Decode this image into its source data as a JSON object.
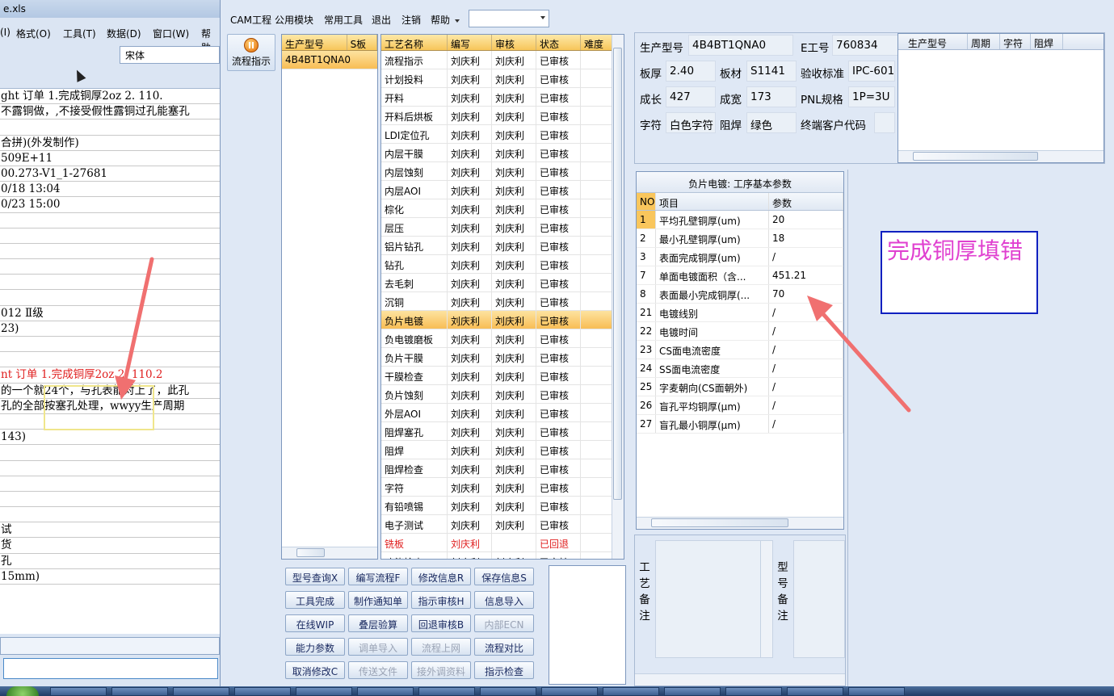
{
  "excel": {
    "title": "e.xls",
    "menu": [
      "(I)",
      "格式(O)",
      "工具(T)",
      "数据(D)",
      "窗口(W)",
      "帮助"
    ],
    "font_name": "宋体",
    "rows": [
      "ght 订单  1.完成铜厚2oz  2.  110.",
      "不露铜做，,不接受假性露铜过孔能塞孔",
      "",
      "合拼)(外发制作)",
      "509E+11",
      "00.273-V1_1-27681",
      "0/18 13:04",
      "0/23 15:00",
      "",
      "",
      "",
      "",
      "",
      "",
      "012 Ⅱ级",
      "23)",
      "",
      "",
      "nt 订单  1.完成铜厚2oz  2.  110.2",
      "的一个就24个，与孔表能对上了，此孔",
      "孔的全部按塞孔处理，wwyy生产周期",
      "",
      "143)",
      "",
      "",
      "",
      "",
      "",
      "试",
      "货",
      "孔",
      "15mm)"
    ]
  },
  "cam": {
    "menu": [
      "CAM工程",
      "公用模块",
      "常用工具",
      "退出",
      "注销",
      "帮助"
    ],
    "combo_value": "",
    "flow_button": "流程指示",
    "model_grid": {
      "headers": [
        "生产型号",
        "S板"
      ],
      "rows": [
        [
          "4B4BT1QNA0",
          ""
        ]
      ]
    },
    "process_grid": {
      "headers": [
        "工艺名称",
        "编写",
        "审核",
        "状态",
        "难度"
      ],
      "rows": [
        [
          "流程指示",
          "刘庆利",
          "刘庆利",
          "已审核",
          ""
        ],
        [
          "计划投料",
          "刘庆利",
          "刘庆利",
          "已审核",
          ""
        ],
        [
          "开料",
          "刘庆利",
          "刘庆利",
          "已审核",
          ""
        ],
        [
          "开料后烘板",
          "刘庆利",
          "刘庆利",
          "已审核",
          ""
        ],
        [
          "LDI定位孔",
          "刘庆利",
          "刘庆利",
          "已审核",
          ""
        ],
        [
          "内层干膜",
          "刘庆利",
          "刘庆利",
          "已审核",
          ""
        ],
        [
          "内层蚀刻",
          "刘庆利",
          "刘庆利",
          "已审核",
          ""
        ],
        [
          "内层AOI",
          "刘庆利",
          "刘庆利",
          "已审核",
          ""
        ],
        [
          "棕化",
          "刘庆利",
          "刘庆利",
          "已审核",
          ""
        ],
        [
          "层压",
          "刘庆利",
          "刘庆利",
          "已审核",
          ""
        ],
        [
          "铝片钻孔",
          "刘庆利",
          "刘庆利",
          "已审核",
          ""
        ],
        [
          "钻孔",
          "刘庆利",
          "刘庆利",
          "已审核",
          ""
        ],
        [
          "去毛刺",
          "刘庆利",
          "刘庆利",
          "已审核",
          ""
        ],
        [
          "沉铜",
          "刘庆利",
          "刘庆利",
          "已审核",
          ""
        ],
        [
          "负片电镀",
          "刘庆利",
          "刘庆利",
          "已审核",
          ""
        ],
        [
          "负电镀磨板",
          "刘庆利",
          "刘庆利",
          "已审核",
          ""
        ],
        [
          "负片干膜",
          "刘庆利",
          "刘庆利",
          "已审核",
          ""
        ],
        [
          "干膜检查",
          "刘庆利",
          "刘庆利",
          "已审核",
          ""
        ],
        [
          "负片蚀刻",
          "刘庆利",
          "刘庆利",
          "已审核",
          ""
        ],
        [
          "外层AOI",
          "刘庆利",
          "刘庆利",
          "已审核",
          ""
        ],
        [
          "阻焊塞孔",
          "刘庆利",
          "刘庆利",
          "已审核",
          ""
        ],
        [
          "阻焊",
          "刘庆利",
          "刘庆利",
          "已审核",
          ""
        ],
        [
          "阻焊检查",
          "刘庆利",
          "刘庆利",
          "已审核",
          ""
        ],
        [
          "字符",
          "刘庆利",
          "刘庆利",
          "已审核",
          ""
        ],
        [
          "有铅喷锡",
          "刘庆利",
          "刘庆利",
          "已审核",
          ""
        ],
        [
          "电子测试",
          "刘庆利",
          "刘庆利",
          "已审核",
          ""
        ],
        [
          "铣板",
          "刘庆利",
          "",
          "已回退",
          ""
        ],
        [
          "功能检查",
          "刘庆利",
          "刘庆利",
          "已审核",
          ""
        ]
      ],
      "selected_index": 14,
      "red_index": 26
    },
    "info": {
      "prod_model_label": "生产型号",
      "prod_model": "4B4BT1QNA0",
      "e_no_label": "E工号",
      "e_no": "760834",
      "thickness_label": "板厚",
      "thickness": "2.40",
      "material_label": "板材",
      "material": "S1141",
      "standard_label": "验收标准",
      "standard": "IPC-601",
      "length_label": "成长",
      "length": "427",
      "width_label": "成宽",
      "width": "173",
      "pnl_label": "PNL规格",
      "pnl": "1P=3U",
      "char_label": "字符",
      "char": "白色字符",
      "mask_label": "阻焊",
      "mask": "绿色",
      "customer_label": "终端客户代码",
      "customer": ""
    },
    "mini_grid": {
      "headers": [
        "生产型号",
        "周期",
        "字符",
        "阻焊"
      ]
    },
    "params": {
      "title": "负片电镀: 工序基本参数",
      "headers": [
        "NO",
        "项目",
        "参数"
      ],
      "rows": [
        [
          "1",
          "平均孔壁铜厚(um)",
          "20"
        ],
        [
          "2",
          "最小孔壁铜厚(um)",
          "18"
        ],
        [
          "3",
          "表面完成铜厚(um)",
          "/"
        ],
        [
          "7",
          "单面电镀面积（含...",
          "451.21"
        ],
        [
          "8",
          "表面最小完成铜厚(...",
          "70"
        ],
        [
          "21",
          "电镀线别",
          "/"
        ],
        [
          "22",
          "电镀时间",
          "/"
        ],
        [
          "23",
          "CS面电流密度",
          "/"
        ],
        [
          "24",
          "SS面电流密度",
          "/"
        ],
        [
          "25",
          "字麦朝向(CS面朝外)",
          "/"
        ],
        [
          "26",
          "盲孔平均铜厚(μm)",
          "/"
        ],
        [
          "27",
          "盲孔最小铜厚(μm)",
          "/"
        ]
      ]
    },
    "annotation": "完成铜厚填错",
    "remarks": {
      "process_label": "工艺备注",
      "model_label": "型号备注"
    },
    "buttons": [
      [
        "型号查询X",
        "编写流程F",
        "修改信息R",
        "保存信息S"
      ],
      [
        "工具完成",
        "制作通知单",
        "指示审核H",
        "信息导入"
      ],
      [
        "在线WIP",
        "叠层验算",
        "回退审核B",
        "内部ECN"
      ],
      [
        "能力参数",
        "调单导入",
        "流程上网",
        "流程对比"
      ],
      [
        "取消修改C",
        "传送文件",
        "接外调资料",
        "指示检查"
      ]
    ],
    "disabled_buttons": [
      "内部ECN",
      "调单导入",
      "流程上网",
      "传送文件",
      "接外调资料"
    ]
  },
  "colors": {
    "accent": "#f8bd55",
    "annotation_text": "#e040d0",
    "annotation_border": "#1020c0",
    "arrow": "#f07070"
  }
}
